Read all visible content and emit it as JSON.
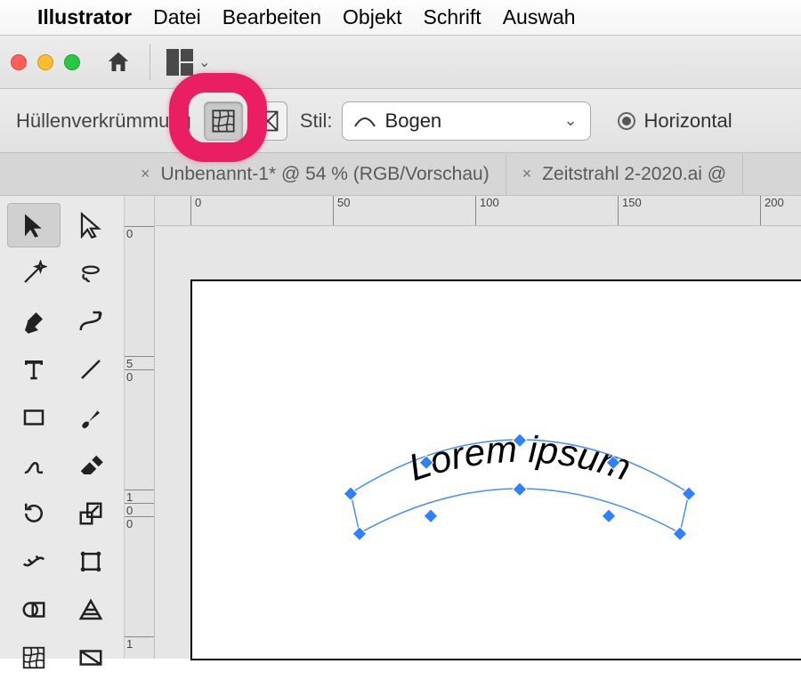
{
  "menubar": {
    "app_name": "Illustrator",
    "items": [
      "Datei",
      "Bearbeiten",
      "Objekt",
      "Schrift",
      "Auswah"
    ]
  },
  "toolbar2": {
    "warp_label": "Hüllenverkrümmung",
    "style_label": "Stil:",
    "style_value": "Bogen",
    "horizontal_label": "Horizontal"
  },
  "tabs": [
    {
      "title": "Unbenannt-1* @ 54 % (RGB/Vorschau)"
    },
    {
      "title": "Zeitstrahl 2-2020.ai @"
    }
  ],
  "ruler": {
    "h": [
      "0",
      "50",
      "100",
      "150",
      "200"
    ],
    "v": [
      "0",
      "5",
      "0",
      "1",
      "0",
      "0",
      "1"
    ]
  },
  "canvas": {
    "text_value": "Lorem ipsum"
  }
}
